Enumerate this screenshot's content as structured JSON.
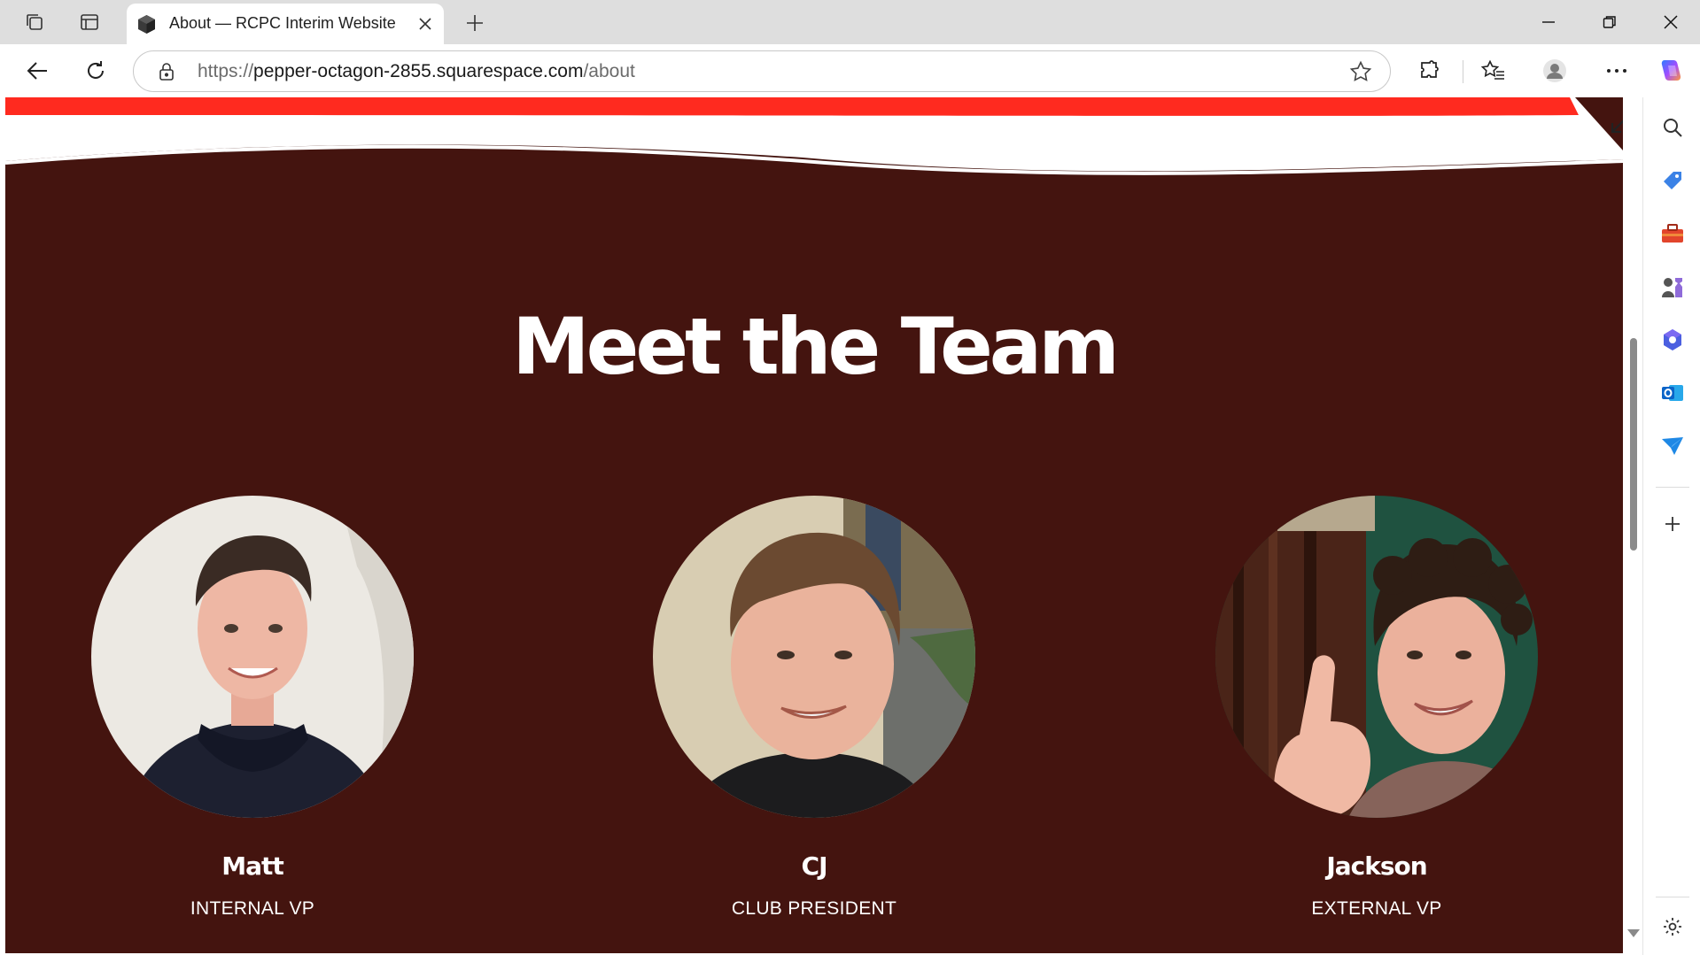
{
  "browser": {
    "tab": {
      "title": "About — RCPC Interim Website"
    },
    "address": {
      "scheme": "https://",
      "host": "pepper-octagon-2855.squarespace.com",
      "path": "/about"
    }
  },
  "page": {
    "heading": "Meet the Team",
    "team": [
      {
        "name": "Matt",
        "role": "INTERNAL VP"
      },
      {
        "name": "CJ",
        "role": "CLUB PRESIDENT"
      },
      {
        "name": "Jackson",
        "role": "EXTERNAL VP"
      }
    ],
    "colors": {
      "background": "#44140f",
      "accent": "#ff2a1f",
      "text": "#ffffff"
    }
  },
  "sidebar": {
    "icons": [
      "search-icon",
      "tag-icon",
      "toolbox-icon",
      "games-icon",
      "copilot-icon",
      "outlook-icon",
      "send-icon",
      "add-icon",
      "settings-icon"
    ]
  }
}
